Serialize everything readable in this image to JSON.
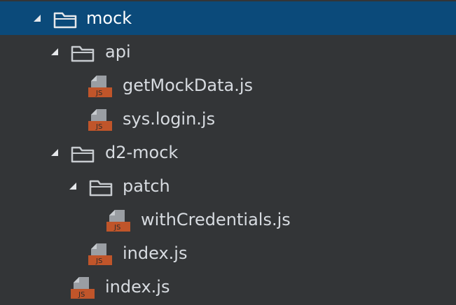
{
  "explorer": {
    "items": [
      {
        "label": "mock",
        "type": "folder",
        "expanded": true,
        "selected": true,
        "depth": 0
      },
      {
        "label": "api",
        "type": "folder",
        "expanded": true,
        "selected": false,
        "depth": 1
      },
      {
        "label": "getMockData.js",
        "type": "js-file",
        "selected": false,
        "depth": 2
      },
      {
        "label": "sys.login.js",
        "type": "js-file",
        "selected": false,
        "depth": 2
      },
      {
        "label": "d2-mock",
        "type": "folder",
        "expanded": true,
        "selected": false,
        "depth": 1
      },
      {
        "label": "patch",
        "type": "folder",
        "expanded": true,
        "selected": false,
        "depth": 2
      },
      {
        "label": "withCredentials.js",
        "type": "js-file",
        "selected": false,
        "depth": 3
      },
      {
        "label": "index.js",
        "type": "js-file",
        "selected": false,
        "depth": 2
      },
      {
        "label": "index.js",
        "type": "js-file",
        "selected": false,
        "depth": 1
      }
    ],
    "js_badge_text": "JS",
    "icons": {
      "folder": "folder-open-icon",
      "file": "javascript-file-icon",
      "caret": "expanded-triangle-icon"
    },
    "colors": {
      "background": "#333537",
      "selection": "#0b4a7a",
      "text": "#d7dbe0",
      "folder_stroke": "#c8ccd0",
      "js_badge": "#c0552a",
      "file_gray": "#9a9ea3"
    }
  }
}
